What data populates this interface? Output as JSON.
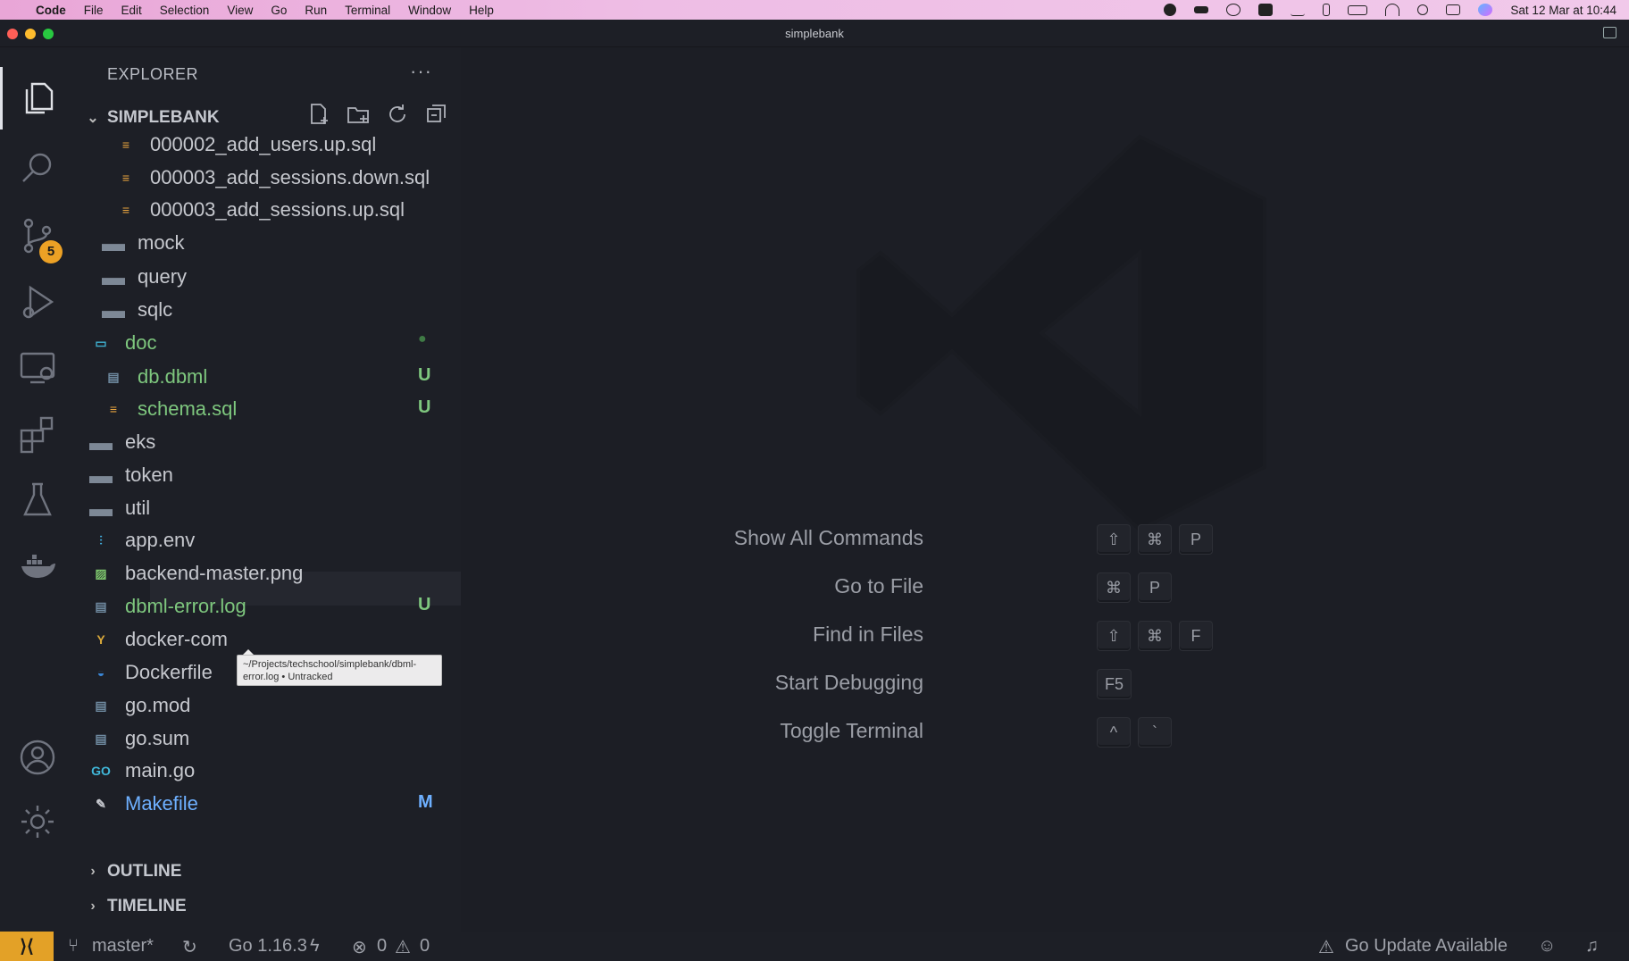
{
  "menubar": {
    "app": "Code",
    "items": [
      "File",
      "Edit",
      "Selection",
      "View",
      "Go",
      "Run",
      "Terminal",
      "Window",
      "Help"
    ],
    "datetime": "Sat 12 Mar at 10:44"
  },
  "window": {
    "title": "simplebank"
  },
  "activity": {
    "scm_badge": "5"
  },
  "explorer": {
    "title": "EXPLORER",
    "more": "···",
    "root": "SIMPLEBANK",
    "files": [
      {
        "label": "000002_add_users.up.sql",
        "icon": "database-icon",
        "status": ""
      },
      {
        "label": "000003_add_sessions.down.sql",
        "icon": "database-icon",
        "status": ""
      },
      {
        "label": "000003_add_sessions.up.sql",
        "icon": "database-icon",
        "status": ""
      },
      {
        "label": "mock",
        "icon": "folder-icon",
        "status": ""
      },
      {
        "label": "query",
        "icon": "folder-icon",
        "status": ""
      },
      {
        "label": "sqlc",
        "icon": "folder-icon",
        "status": ""
      },
      {
        "label": "doc",
        "icon": "folder-open-icon",
        "status": "●"
      },
      {
        "label": "db.dbml",
        "icon": "file-icon",
        "status": "U"
      },
      {
        "label": "schema.sql",
        "icon": "database-icon",
        "status": "U"
      },
      {
        "label": "eks",
        "icon": "folder-icon",
        "status": ""
      },
      {
        "label": "token",
        "icon": "folder-icon",
        "status": ""
      },
      {
        "label": "util",
        "icon": "folder-icon",
        "status": ""
      },
      {
        "label": "app.env",
        "icon": "settings-sliders-icon",
        "status": ""
      },
      {
        "label": "backend-master.png",
        "icon": "image-icon",
        "status": ""
      },
      {
        "label": "dbml-error.log",
        "icon": "file-icon",
        "status": "U"
      },
      {
        "label": "docker-com",
        "icon": "yaml-icon",
        "status": ""
      },
      {
        "label": "Dockerfile",
        "icon": "docker-icon",
        "status": ""
      },
      {
        "label": "go.mod",
        "icon": "file-icon",
        "status": ""
      },
      {
        "label": "go.sum",
        "icon": "file-icon",
        "status": ""
      },
      {
        "label": "main.go",
        "icon": "go-icon",
        "status": ""
      },
      {
        "label": "Makefile",
        "icon": "wrench-icon",
        "status": "M"
      }
    ],
    "tooltip": "~/Projects/techschool/simplebank/dbml-error.log • Untracked",
    "outline": "OUTLINE",
    "timeline": "TIMELINE"
  },
  "commands": [
    {
      "label": "Show All Commands",
      "keys": [
        "⇧",
        "⌘",
        "P"
      ]
    },
    {
      "label": "Go to File",
      "keys": [
        "⌘",
        "P"
      ]
    },
    {
      "label": "Find in Files",
      "keys": [
        "⇧",
        "⌘",
        "F"
      ]
    },
    {
      "label": "Start Debugging",
      "keys": [
        "F5"
      ]
    },
    {
      "label": "Toggle Terminal",
      "keys": [
        "^",
        "`"
      ]
    }
  ],
  "statusbar": {
    "branch": "master*",
    "go_version": "Go 1.16.3",
    "errors": "0",
    "warnings": "0",
    "update": "Go Update Available"
  },
  "colors": {
    "accent": "#e3a127",
    "untracked": "#7ec77e",
    "modified": "#6eb0ff"
  }
}
